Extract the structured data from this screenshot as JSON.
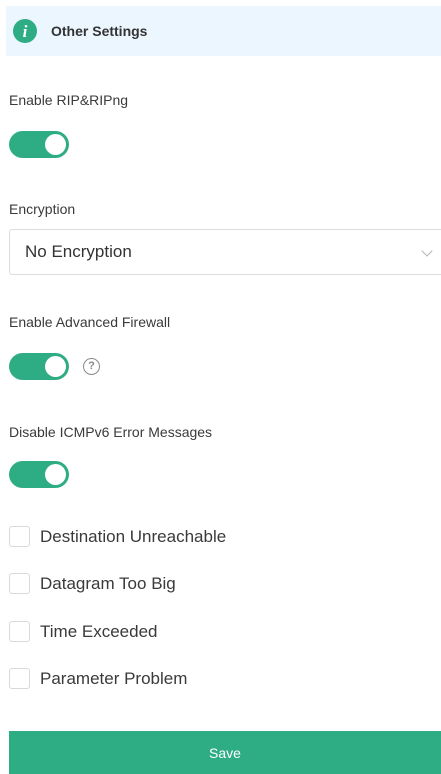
{
  "section": {
    "title": "Other Settings",
    "icon": "info-icon"
  },
  "rip": {
    "label": "Enable RIP&RIPng",
    "enabled": true
  },
  "encryption": {
    "label": "Encryption",
    "value": "No Encryption"
  },
  "firewall": {
    "label": "Enable Advanced Firewall",
    "enabled": true,
    "help_glyph": "?"
  },
  "icmpv6": {
    "label": "Disable ICMPv6 Error Messages",
    "enabled": true,
    "options": [
      {
        "label": "Destination Unreachable",
        "checked": false
      },
      {
        "label": "Datagram Too Big",
        "checked": false
      },
      {
        "label": "Time Exceeded",
        "checked": false
      },
      {
        "label": "Parameter Problem",
        "checked": false
      }
    ]
  },
  "save_label": "Save",
  "colors": {
    "accent": "#2ead84",
    "header_bg": "#ecf6ff"
  }
}
